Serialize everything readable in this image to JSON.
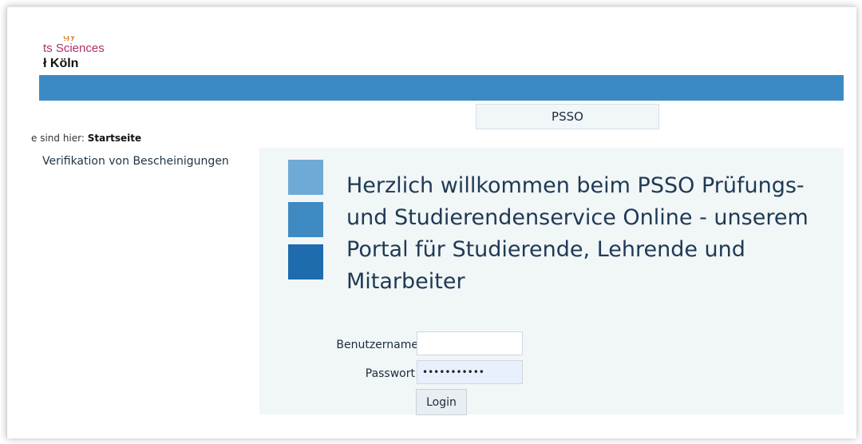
{
  "logo": {
    "line0": "gy",
    "line1": "ts Sciences",
    "line2": "ł Köln"
  },
  "nav": {
    "tab_label": "PSSO"
  },
  "breadcrumb": {
    "prefix": "e sind hier: ",
    "current": "Startseite"
  },
  "sidebar": {
    "items": [
      {
        "label": "Verifikation von Bescheinigungen"
      }
    ]
  },
  "welcome": {
    "text": "Herzlich willkommen beim PSSO Prüfungs- und Studierendenservice Online - unserem Portal für Studierende, Lehrende und Mitarbeiter"
  },
  "login": {
    "username_label": "Benutzername",
    "username_value": "",
    "password_label": "Passwort",
    "password_value": "•••••••••••",
    "button_label": "Login"
  },
  "colors": {
    "header_bar": "#3b8ac4",
    "square_light": "#6fa9d5",
    "square_mid": "#3f8ac3",
    "square_dark": "#1e6bad",
    "panel_bg": "#f1f6f7",
    "logo_accent": "#b0306a"
  }
}
